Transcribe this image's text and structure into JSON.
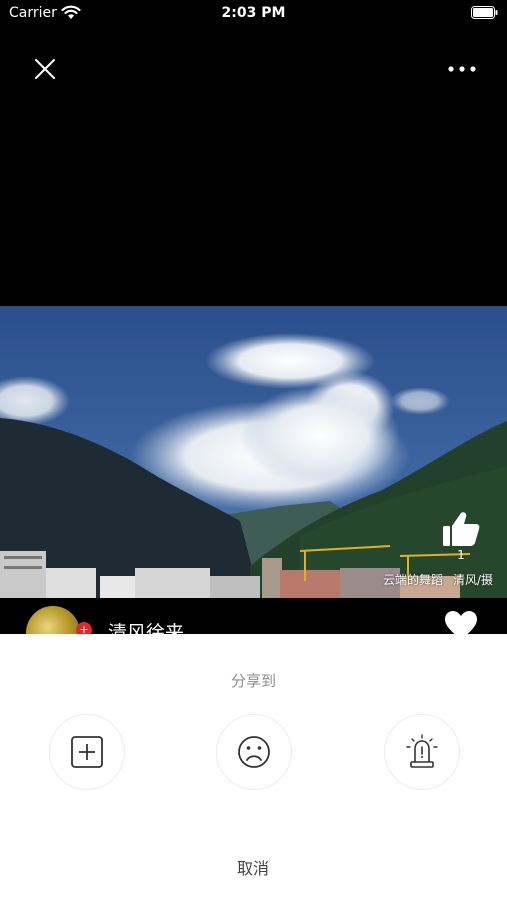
{
  "status_bar": {
    "carrier": "Carrier",
    "time": "2:03 PM"
  },
  "nav": {
    "close_icon": "close-icon",
    "more_icon": "more-dots-icon"
  },
  "photo": {
    "like_count": "1",
    "caption_title": "云端的舞蹈",
    "caption_author": "清风/摄"
  },
  "author": {
    "name": "清风徐来",
    "badge": "+"
  },
  "share_sheet": {
    "title": "分享到",
    "options": [
      {
        "icon": "add-square-icon"
      },
      {
        "icon": "sad-face-icon"
      },
      {
        "icon": "alarm-siren-icon"
      }
    ],
    "cancel_label": "取消"
  },
  "colors": {
    "background": "#000000",
    "sheet": "#ffffff",
    "sheet_title": "#8e8e8e"
  }
}
